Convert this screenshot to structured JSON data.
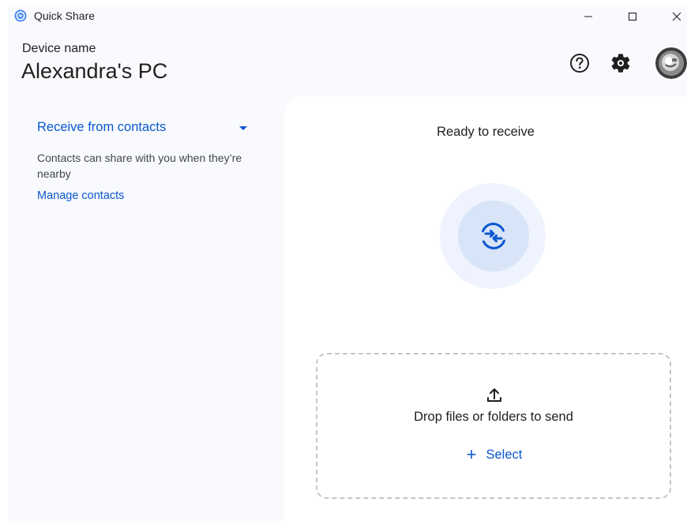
{
  "window": {
    "title": "Quick Share",
    "controls": {
      "minimize": "minimize-icon",
      "maximize": "maximize-icon",
      "close": "close-icon"
    }
  },
  "header": {
    "device_label": "Device name",
    "device_name": "Alexandra's PC",
    "icons": [
      "help-icon",
      "settings-icon",
      "avatar"
    ]
  },
  "sidebar": {
    "receive_mode": "Receive from contacts",
    "description": "Contacts can share with you when they’re nearby",
    "manage_link": "Manage contacts"
  },
  "main": {
    "status": "Ready to receive",
    "drop_text": "Drop files or folders to send",
    "select_label": "Select",
    "select_icon": "+"
  },
  "colors": {
    "accent": "#0b57d0",
    "background": "#f8fafd",
    "card": "#ffffff"
  }
}
